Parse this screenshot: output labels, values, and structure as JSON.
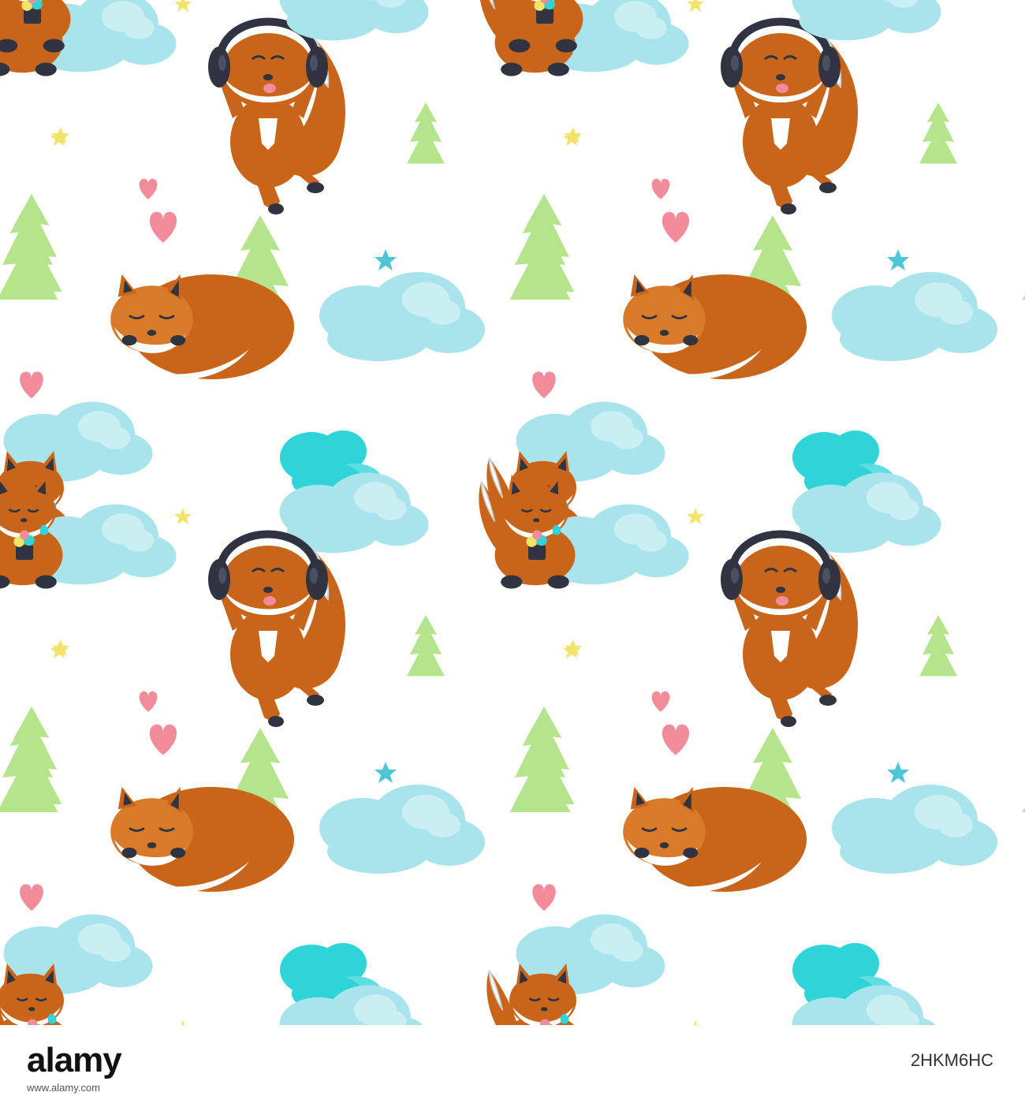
{
  "colors": {
    "background": "#ffffff",
    "fox_orange": "#C8651B",
    "fox_light": "#D97A2B",
    "fox_white": "#ffffff",
    "fox_dark": "#2F3440",
    "tree_green": "#B5E48C",
    "cloud_light": "#A9E4EC",
    "cloud_bright": "#2FD4D9",
    "heart_pink": "#F28C9A",
    "star_yellow": "#F2E36A",
    "star_teal": "#4FC6D6",
    "headphones": "#2F3440"
  },
  "motifs": {
    "fox_headphones": "fox-with-headphones",
    "fox_sleeping": "sleeping-fox",
    "fox_flowers": "fox-holding-flowers",
    "tree": "fir-tree",
    "cloud": "cloud",
    "heart": "heart",
    "star": "star"
  },
  "footer": {
    "logo": "alamy",
    "image_id": "2HKM6HC",
    "meta": "www.alamy.com"
  }
}
